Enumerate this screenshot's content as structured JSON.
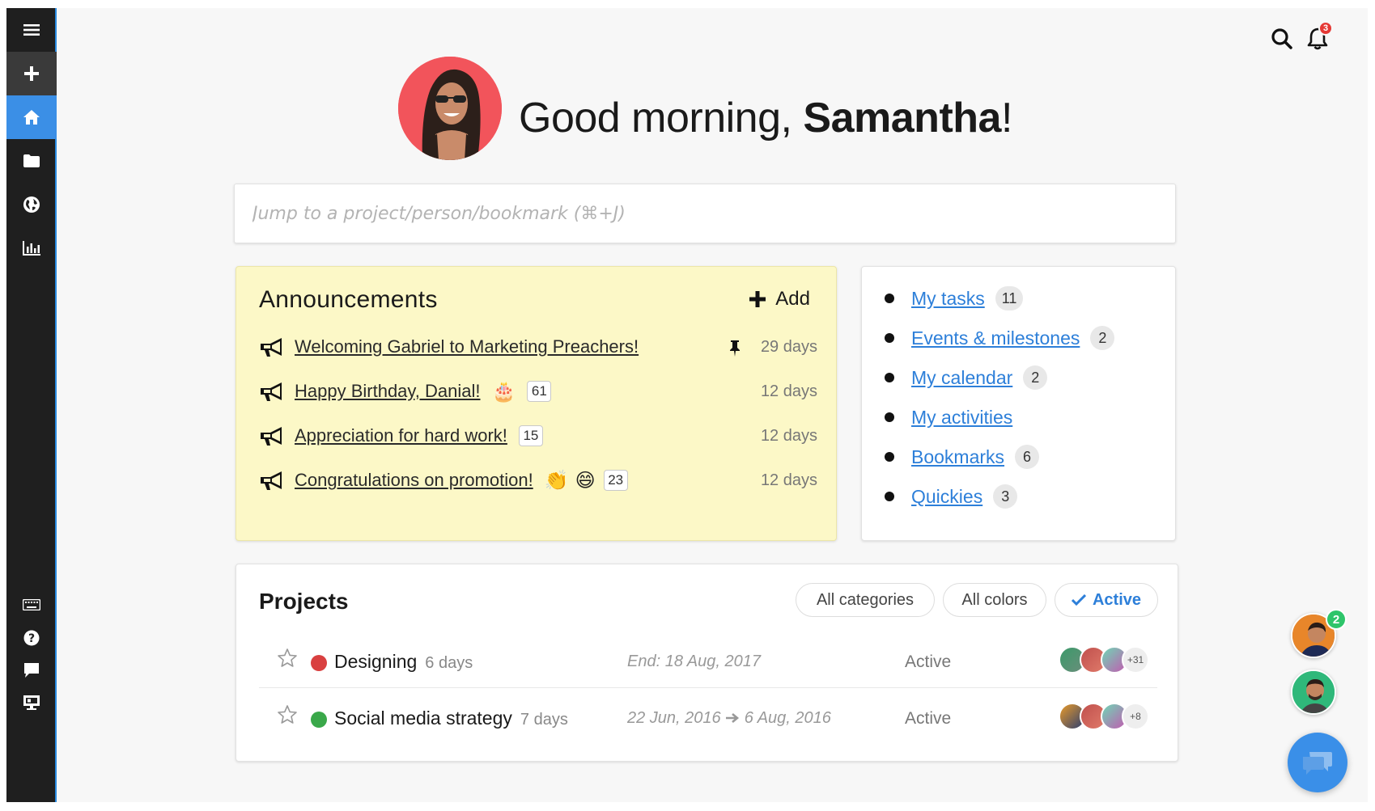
{
  "sidebar": {
    "items": [
      {
        "icon": "menu-icon"
      },
      {
        "icon": "plus-icon"
      },
      {
        "icon": "home-icon"
      },
      {
        "icon": "folder-icon"
      },
      {
        "icon": "globe-icon"
      },
      {
        "icon": "bar-chart-icon"
      }
    ],
    "bottom_items": [
      {
        "icon": "keyboard-icon"
      },
      {
        "icon": "help-icon"
      },
      {
        "icon": "comment-icon"
      },
      {
        "icon": "monitor-icon"
      }
    ],
    "colors": {
      "background": "#1f1f1f",
      "active": "#3b8fe6"
    }
  },
  "header": {
    "notification_count": "3"
  },
  "greeting": {
    "prefix": "Good morning, ",
    "name": "Samantha",
    "suffix": "!"
  },
  "jump": {
    "placeholder": "Jump to a project/person/bookmark (⌘+J)"
  },
  "announcements": {
    "title": "Announcements",
    "add_label": "Add",
    "items": [
      {
        "title": "Welcoming Gabriel to Marketing Preachers!",
        "days": "29 days",
        "pinned": true
      },
      {
        "title": "Happy Birthday, Danial!",
        "emoji": "🎂",
        "count": "61",
        "days": "12 days"
      },
      {
        "title": "Appreciation for hard work!",
        "count": "15",
        "days": "12 days"
      },
      {
        "title": "Congratulations on promotion!",
        "emoji": "👏",
        "emoji2": "😄",
        "count": "23",
        "days": "12 days"
      }
    ],
    "background": "#fcf8c7"
  },
  "quick_links": {
    "items": [
      {
        "label": "My tasks",
        "count": "11"
      },
      {
        "label": "Events & milestones",
        "count": "2"
      },
      {
        "label": "My calendar",
        "count": "2"
      },
      {
        "label": "My activities"
      },
      {
        "label": "Bookmarks",
        "count": "6"
      },
      {
        "label": "Quickies",
        "count": "3"
      }
    ],
    "link_color": "#2d7fd9"
  },
  "projects": {
    "title": "Projects",
    "filters": {
      "categories": "All categories",
      "colors": "All colors",
      "active": "Active"
    },
    "rows": [
      {
        "name": "Designing",
        "days": "6 days",
        "date": "End: 18 Aug, 2017",
        "status": "Active",
        "color": "#d94040",
        "more": "+31"
      },
      {
        "name": "Social media strategy",
        "days": "7 days",
        "date_start": "22 Jun, 2016",
        "date_end": "6 Aug, 2016",
        "status": "Active",
        "color": "#3aa84a",
        "more": "+8"
      }
    ]
  },
  "floating": {
    "chat_badge": "2"
  }
}
